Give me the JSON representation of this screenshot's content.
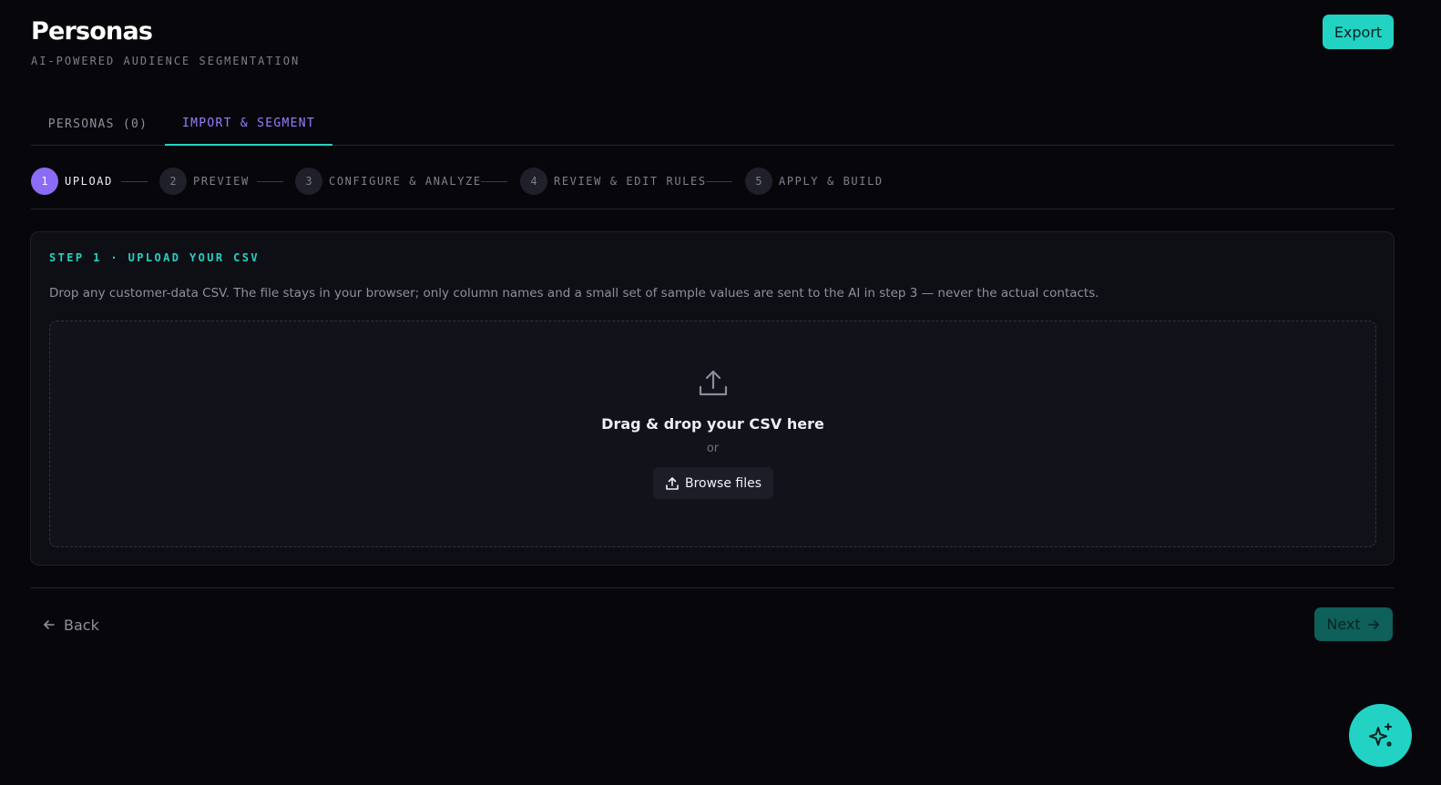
{
  "header": {
    "title": "Personas",
    "subtitle": "AI-POWERED AUDIENCE SEGMENTATION",
    "export_label": "Export"
  },
  "tabs": [
    {
      "label": "PERSONAS (0)",
      "active": false
    },
    {
      "label": "IMPORT & SEGMENT",
      "active": true
    }
  ],
  "steps": [
    {
      "num": "1",
      "label": "UPLOAD",
      "active": true
    },
    {
      "num": "2",
      "label": "PREVIEW",
      "active": false
    },
    {
      "num": "3",
      "label": "CONFIGURE & ANALYZE",
      "active": false
    },
    {
      "num": "4",
      "label": "REVIEW & EDIT RULES",
      "active": false
    },
    {
      "num": "5",
      "label": "APPLY & BUILD",
      "active": false
    }
  ],
  "card": {
    "heading": "STEP 1 · UPLOAD YOUR CSV",
    "description": "Drop any customer-data CSV. The file stays in your browser; only column names and a small set of sample values are sent to the AI in step 3 — never the actual contacts.",
    "dropzone": {
      "title": "Drag & drop your CSV here",
      "or": "or",
      "browse_label": "Browse files",
      "icon": "upload-icon"
    }
  },
  "footer": {
    "back_label": "Back",
    "next_label": "Next"
  },
  "fab": {
    "icon": "sparkle-icon"
  },
  "colors": {
    "background": "#07070b",
    "accent_teal": "#22d3c4",
    "accent_purple": "#8b6cf6",
    "card": "#0e0f15"
  }
}
